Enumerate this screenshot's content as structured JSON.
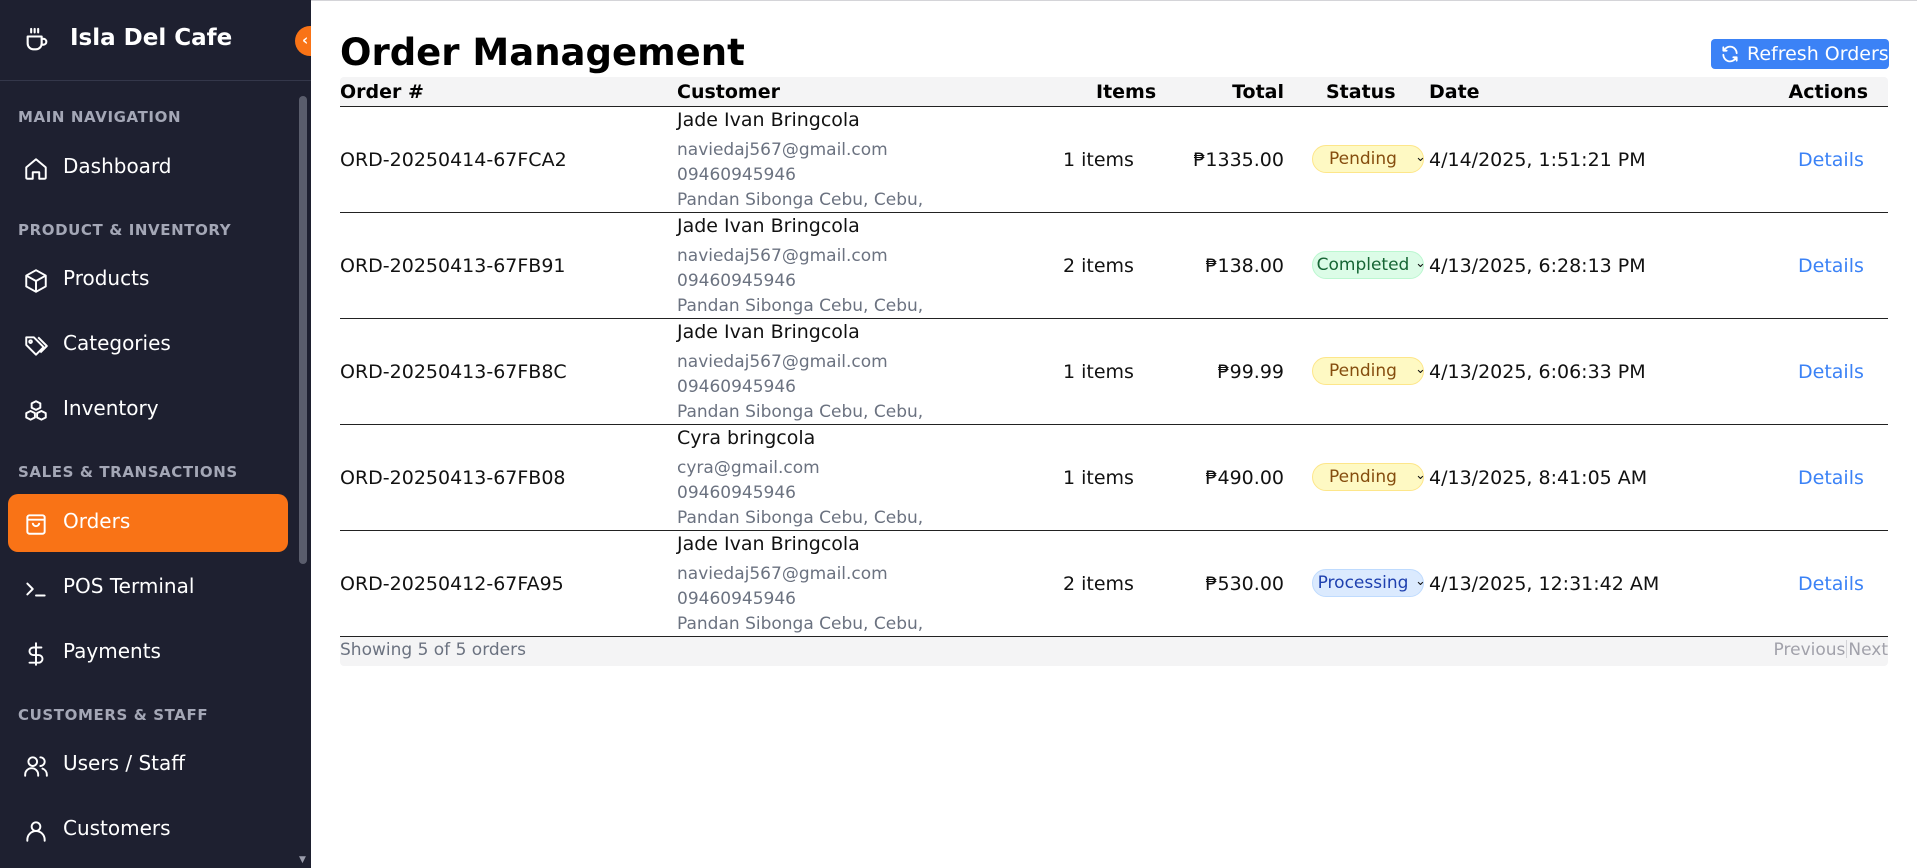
{
  "app": {
    "name": "Isla Del Cafe"
  },
  "sidebar": {
    "sections": [
      {
        "label": "MAIN NAVIGATION"
      },
      {
        "label": "PRODUCT & INVENTORY"
      },
      {
        "label": "SALES & TRANSACTIONS"
      },
      {
        "label": "CUSTOMERS & STAFF"
      }
    ],
    "items": [
      {
        "label": "Dashboard",
        "icon": "home-icon"
      },
      {
        "label": "Products",
        "icon": "box-icon"
      },
      {
        "label": "Categories",
        "icon": "tag-icon"
      },
      {
        "label": "Inventory",
        "icon": "boxes-icon"
      },
      {
        "label": "Orders",
        "icon": "shopping-bag-icon",
        "active": true
      },
      {
        "label": "POS Terminal",
        "icon": "terminal-icon"
      },
      {
        "label": "Payments",
        "icon": "dollar-icon"
      },
      {
        "label": "Users / Staff",
        "icon": "users-icon"
      },
      {
        "label": "Customers",
        "icon": "user-icon"
      }
    ]
  },
  "header": {
    "title": "Order Management",
    "refresh_label": "Refresh Orders"
  },
  "table": {
    "columns": [
      "Order #",
      "Customer",
      "Items",
      "Total",
      "Status",
      "Date",
      "Actions"
    ],
    "rows": [
      {
        "order_id": "ORD-20250414-67FCA2",
        "name": "Jade Ivan Bringcola",
        "email": "naviedaj567@gmail.com",
        "phone": "09460945946",
        "address": "Pandan Sibonga Cebu, Cebu,",
        "items": "1 items",
        "total": "₱1335.00",
        "status": "Pending",
        "date": "4/14/2025, 1:51:21 PM",
        "action": "Details"
      },
      {
        "order_id": "ORD-20250413-67FB91",
        "name": "Jade Ivan Bringcola",
        "email": "naviedaj567@gmail.com",
        "phone": "09460945946",
        "address": "Pandan Sibonga Cebu, Cebu,",
        "items": "2 items",
        "total": "₱138.00",
        "status": "Completed",
        "date": "4/13/2025, 6:28:13 PM",
        "action": "Details"
      },
      {
        "order_id": "ORD-20250413-67FB8C",
        "name": "Jade Ivan Bringcola",
        "email": "naviedaj567@gmail.com",
        "phone": "09460945946",
        "address": "Pandan Sibonga Cebu, Cebu,",
        "items": "1 items",
        "total": "₱99.99",
        "status": "Pending",
        "date": "4/13/2025, 6:06:33 PM",
        "action": "Details"
      },
      {
        "order_id": "ORD-20250413-67FB08",
        "name": "Cyra bringcola",
        "email": "cyra@gmail.com",
        "phone": "09460945946",
        "address": "Pandan Sibonga Cebu, Cebu,",
        "items": "1 items",
        "total": "₱490.00",
        "status": "Pending",
        "date": "4/13/2025, 8:41:05 AM",
        "action": "Details"
      },
      {
        "order_id": "ORD-20250412-67FA95",
        "name": "Jade Ivan Bringcola",
        "email": "naviedaj567@gmail.com",
        "phone": "09460945946",
        "address": "Pandan Sibonga Cebu, Cebu,",
        "items": "2 items",
        "total": "₱530.00",
        "status": "Processing",
        "date": "4/13/2025, 12:31:42 AM",
        "action": "Details"
      }
    ]
  },
  "footer": {
    "summary": "Showing 5 of 5 orders",
    "previous_label": "Previous",
    "next_label": "Next"
  },
  "colors": {
    "sidebar_bg": "#1e2030",
    "accent": "#f97316",
    "primary": "#3b82f6"
  }
}
